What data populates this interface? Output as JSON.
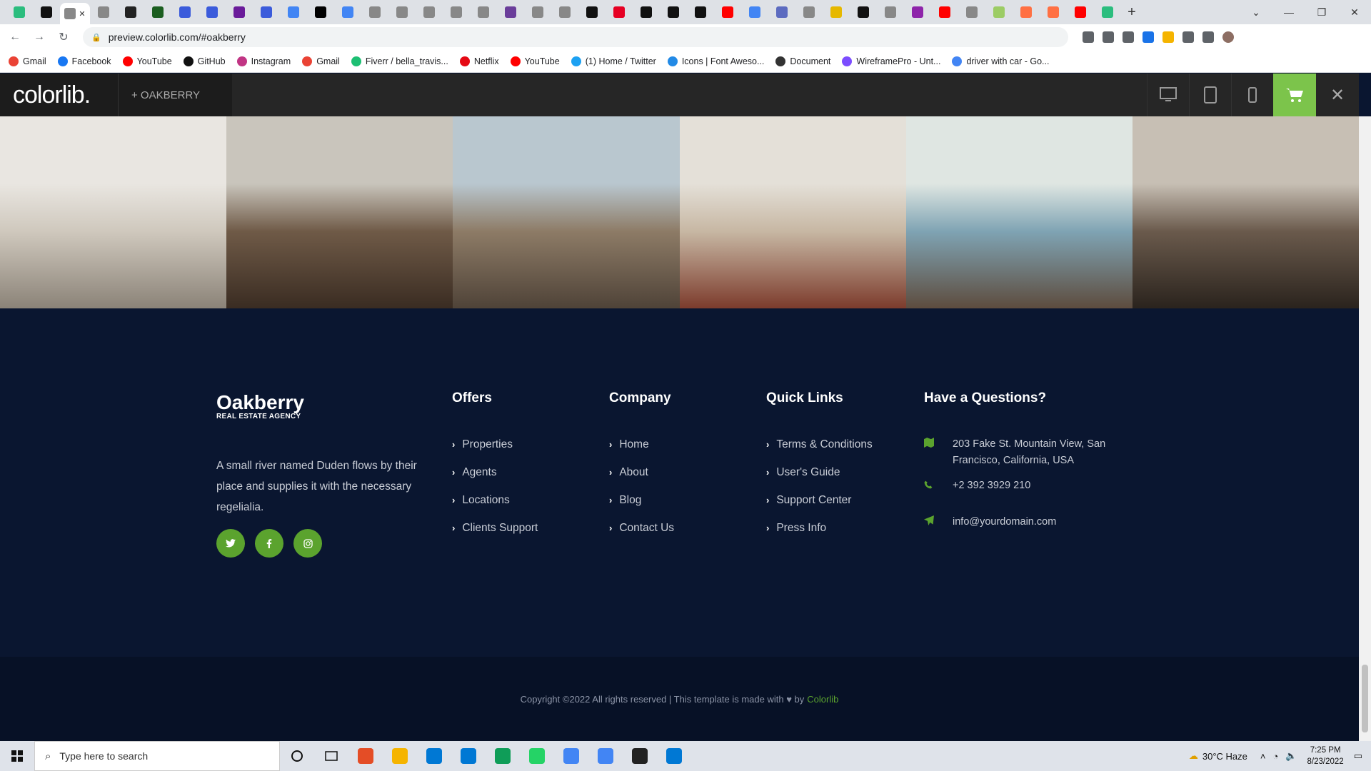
{
  "browser": {
    "tab_favicon_colors": [
      "#2bbd7e",
      "#111",
      "#888",
      "#888",
      "#222",
      "#1b5e20",
      "#3b5bdb",
      "#3b5bdb",
      "#6a1b9a",
      "#3b5bdb",
      "#4285f4",
      "#000",
      "#4285f4",
      "#888",
      "#888",
      "#888",
      "#888",
      "#888",
      "#6a3d9a",
      "#888",
      "#888",
      "#111",
      "#e60023",
      "#111",
      "#111",
      "#111",
      "#ff0000",
      "#4285f4",
      "#5c6bc0",
      "#888",
      "#e6b800",
      "#111",
      "#888",
      "#8e24aa",
      "#ff0000",
      "#888",
      "#9ccc65",
      "#ff7043",
      "#ff7043",
      "#ff0000",
      "#2bbd7e"
    ],
    "new_tab_label": "+",
    "url": "preview.colorlib.com/#oakberry",
    "bookmarks": [
      {
        "label": "Gmail",
        "color": "#ea4335"
      },
      {
        "label": "Facebook",
        "color": "#1877f2"
      },
      {
        "label": "YouTube",
        "color": "#ff0000"
      },
      {
        "label": "GitHub",
        "color": "#111"
      },
      {
        "label": "Instagram",
        "color": "#c13584"
      },
      {
        "label": "Gmail",
        "color": "#ea4335"
      },
      {
        "label": "Fiverr / bella_travis...",
        "color": "#1dbf73"
      },
      {
        "label": "Netflix",
        "color": "#e50914"
      },
      {
        "label": "YouTube",
        "color": "#ff0000"
      },
      {
        "label": "(1) Home / Twitter",
        "color": "#1da1f2"
      },
      {
        "label": "Icons | Font Aweso...",
        "color": "#228ae6"
      },
      {
        "label": "Document",
        "color": "#333"
      },
      {
        "label": "WireframePro - Unt...",
        "color": "#7c4dff"
      },
      {
        "label": "driver with car - Go...",
        "color": "#4285f4"
      }
    ]
  },
  "colorlib_bar": {
    "logo": "colorlib.",
    "theme_name": "+   OAKBERRY"
  },
  "gallery": {
    "images": [
      {
        "name": "dining-room",
        "colors": [
          "#e9e6e1",
          "#cfc8bd",
          "#8b8378"
        ]
      },
      {
        "name": "kitchen",
        "colors": [
          "#c9c5bc",
          "#6f5a47",
          "#3a2c22"
        ]
      },
      {
        "name": "loft-view",
        "colors": [
          "#b9c7cf",
          "#8d7b66",
          "#4f4338"
        ]
      },
      {
        "name": "living-room",
        "colors": [
          "#e4e0d8",
          "#c7b7a3",
          "#7c3b2c"
        ]
      },
      {
        "name": "lounge",
        "colors": [
          "#dfe6e2",
          "#7fa3b3",
          "#5d4c3e"
        ]
      },
      {
        "name": "dining-table",
        "colors": [
          "#c7bfb4",
          "#6a5a4c",
          "#2a231d"
        ]
      }
    ]
  },
  "footer": {
    "brand": "Oakberry",
    "tagline": "REAL ESTATE AGENCY",
    "description": "A small river named Duden flows by their place and supplies it with the necessary regelialia.",
    "social": [
      "t",
      "f",
      "ig"
    ],
    "offers": {
      "title": "Offers",
      "items": [
        "Properties",
        "Agents",
        "Locations",
        "Clients Support"
      ]
    },
    "company": {
      "title": "Company",
      "items": [
        "Home",
        "About",
        "Blog",
        "Contact Us"
      ]
    },
    "quick_links": {
      "title": "Quick Links",
      "items": [
        "Terms & Conditions",
        "User's Guide",
        "Support Center",
        "Press Info"
      ]
    },
    "contact": {
      "title": "Have a Questions?",
      "address": "203 Fake St. Mountain View, San Francisco, California, USA",
      "phone": "+2 392 3929 210",
      "email": "info@yourdomain.com"
    },
    "copyright_prefix": "Copyright ©2022 All rights reserved | This template is made with ♥ by",
    "copyright_link": "Colorlib"
  },
  "taskbar": {
    "search_placeholder": "Type here to search",
    "weather": "30°C  Haze",
    "time": "7:25 PM",
    "date": "8/23/2022",
    "app_colors": [
      "#e44d26",
      "#f5b400",
      "#0078d4",
      "#0078d4",
      "#0f9d58",
      "#25d366",
      "#4285f4",
      "#4285f4",
      "#222",
      "#0078d4"
    ]
  }
}
